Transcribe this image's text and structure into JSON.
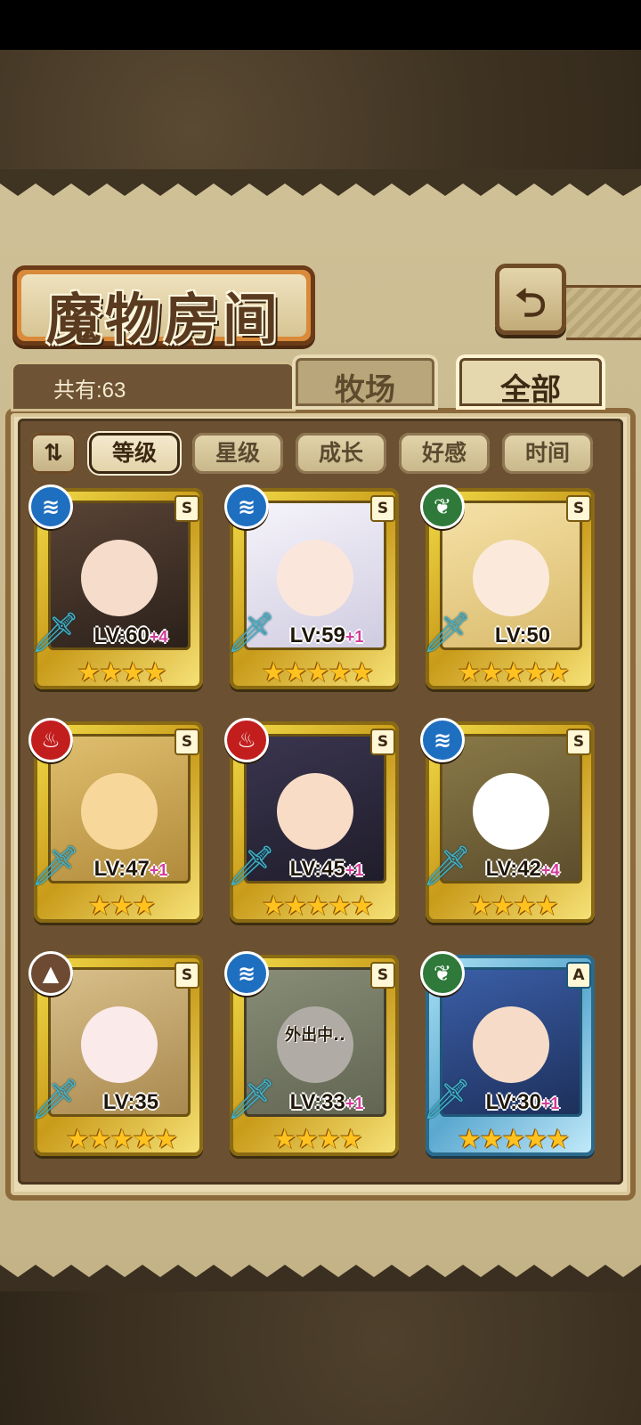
{
  "header": {
    "title": "魔物房间",
    "back_icon": "return-arrow-icon"
  },
  "summary": {
    "count_text": "共有:63"
  },
  "tabs": [
    {
      "label": "牧场",
      "active": false
    },
    {
      "label": "全部",
      "active": true
    }
  ],
  "sort": {
    "toggle_icon": "sort-order-icon",
    "toggle_glyph": "⇅",
    "options": [
      {
        "label": "等级",
        "active": true
      },
      {
        "label": "星级",
        "active": false
      },
      {
        "label": "成长",
        "active": false
      },
      {
        "label": "好感",
        "active": false
      },
      {
        "label": "时间",
        "active": false
      }
    ]
  },
  "monsters": [
    {
      "element": "water",
      "element_glyph": "≋",
      "rank": "S",
      "level": "LV:60",
      "plus": "+4",
      "stars": 4,
      "stars_text": "★★★★",
      "status": "",
      "frame": "gold",
      "art_color": "#3b2a22"
    },
    {
      "element": "water",
      "element_glyph": "≋",
      "rank": "S",
      "level": "LV:59",
      "plus": "+1",
      "stars": 5,
      "stars_text": "★★★★★",
      "status": "",
      "frame": "gold",
      "art_color": "#e8e6ef"
    },
    {
      "element": "wood",
      "element_glyph": "❦",
      "rank": "S",
      "level": "LV:50",
      "plus": "",
      "stars": 5,
      "stars_text": "★★★★★",
      "status": "",
      "frame": "gold",
      "art_color": "#f1d89a"
    },
    {
      "element": "fire",
      "element_glyph": "♨",
      "rank": "S",
      "level": "LV:47",
      "plus": "+1",
      "stars": 3,
      "stars_text": "★★★",
      "status": "",
      "frame": "gold",
      "art_color": "#f0cf8a"
    },
    {
      "element": "fire",
      "element_glyph": "♨",
      "rank": "S",
      "level": "LV:45",
      "plus": "+1",
      "stars": 5,
      "stars_text": "★★★★★",
      "status": "",
      "frame": "gold",
      "art_color": "#2c2a3a"
    },
    {
      "element": "water",
      "element_glyph": "≋",
      "rank": "S",
      "level": "LV:42",
      "plus": "+4",
      "stars": 4,
      "stars_text": "★★★★",
      "status": "",
      "frame": "gold",
      "art_color": "#f4f4f4"
    },
    {
      "element": "earth",
      "element_glyph": "▲",
      "rank": "S",
      "level": "LV:35",
      "plus": "",
      "stars": 5,
      "stars_text": "★★★★★",
      "status": "",
      "frame": "gold",
      "art_color": "#f2eef2"
    },
    {
      "element": "water",
      "element_glyph": "≋",
      "rank": "S",
      "level": "LV:33",
      "plus": "+1",
      "stars": 4,
      "stars_text": "★★★★",
      "status": "外出中..",
      "frame": "gold",
      "art_color": "#cfc29a"
    },
    {
      "element": "wood",
      "element_glyph": "❦",
      "rank": "A",
      "level": "LV:30",
      "plus": "+1",
      "stars": 5,
      "stars_text": "★★★★★",
      "status": "",
      "frame": "blue",
      "art_color": "#2a4f9a"
    }
  ],
  "colors": {
    "gold_frame": "#e9c934",
    "blue_frame": "#7cc6e6",
    "plus_text": "#d43a9b",
    "star": "#ffc21f"
  }
}
